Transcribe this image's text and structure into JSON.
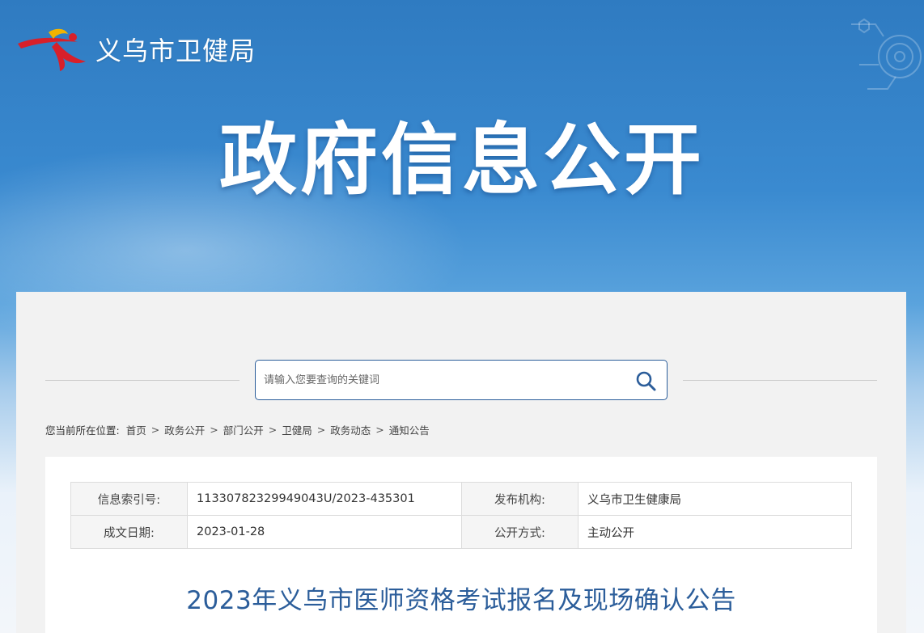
{
  "header": {
    "logo_text": "义乌市卫健局",
    "hero_title": "政府信息公开"
  },
  "search": {
    "placeholder": "请输入您要查询的关键词"
  },
  "breadcrumb": {
    "lead": "您当前所在位置:",
    "items": [
      "首页",
      "政务公开",
      "部门公开",
      "卫健局",
      "政务动态",
      "通知公告"
    ],
    "separator": ">"
  },
  "meta": {
    "index_label": "信息索引号:",
    "index_value": "11330782329949043U/2023-435301",
    "publisher_label": "发布机构:",
    "publisher_value": "义乌市卫生健康局",
    "date_label": "成文日期:",
    "date_value": "2023-01-28",
    "mode_label": "公开方式:",
    "mode_value": "主动公开"
  },
  "article": {
    "title": "2023年义乌市医师资格考试报名及现场确认公告"
  },
  "colors": {
    "brand_blue": "#2b5d9a",
    "banner_blue": "#2f7bc1",
    "logo_red": "#d8202a"
  },
  "icons": {
    "logo": "yiwu-health-logo-icon",
    "search": "search-icon"
  }
}
